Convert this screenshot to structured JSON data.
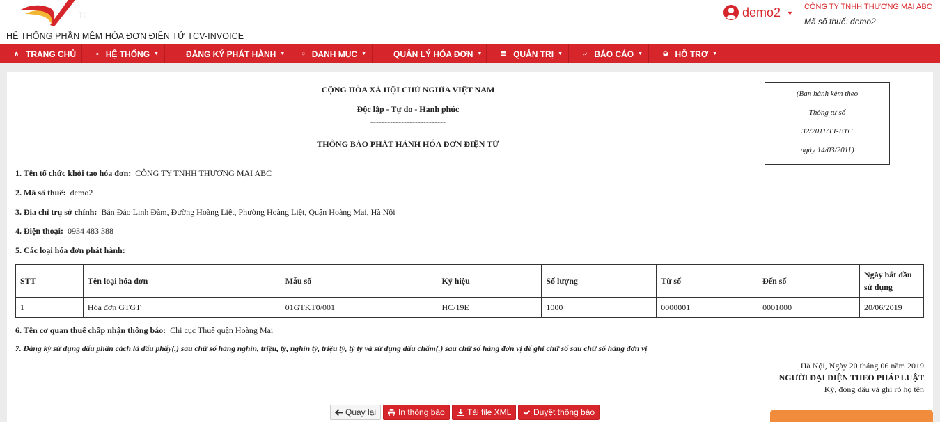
{
  "header": {
    "app_title": "HỆ THỐNG PHẦN MỀM HÓA ĐƠN ĐIỆN TỬ TCV-INVOICE",
    "user_name": "demo2",
    "company": "CÔNG TY TNHH THƯƠNG MẠI ABC",
    "tax_code": "Mã số thuế: demo2"
  },
  "nav": {
    "items": [
      {
        "label": "TRANG CHỦ",
        "icon": "home-icon"
      },
      {
        "label": "HỆ THỐNG",
        "icon": "gear-icon"
      },
      {
        "label": "ĐĂNG KÝ PHÁT HÀNH",
        "icon": "plane-icon"
      },
      {
        "label": "DANH MỤC",
        "icon": "book-icon"
      },
      {
        "label": "QUẢN LÝ HÓA ĐƠN",
        "icon": "file-icon"
      },
      {
        "label": "QUẢN TRỊ",
        "icon": "server-icon"
      },
      {
        "label": "BÁO CÁO",
        "icon": "chart-icon"
      },
      {
        "label": "HỖ TRỢ",
        "icon": "cube-icon"
      }
    ]
  },
  "document": {
    "national_title": "CỘNG HÒA XÃ HỘI CHỦ NGHĨA VIỆT NAM",
    "motto": "Độc lập - Tự do - Hạnh phúc",
    "separator": "---------------------------",
    "title": "THÔNG BÁO PHÁT HÀNH HÓA ĐƠN ĐIỆN TỬ",
    "ban_hanh": [
      "(Ban hành kèm theo",
      "Thông tư số",
      "32/2011/TT-BTC",
      "ngày 14/03/2011)"
    ],
    "fields": [
      {
        "label": "1. Tên tổ chức khởi tạo hóa đơn:",
        "value": "CÔNG TY TNHH THƯƠNG MẠI ABC"
      },
      {
        "label": "2. Mã số thuế:",
        "value": "demo2"
      },
      {
        "label": "3. Địa chỉ trụ sở chính:",
        "value": "Bán Đảo Linh Đàm, Đường Hoàng Liệt, Phường Hoàng Liệt, Quận Hoàng Mai, Hà Nội"
      },
      {
        "label": "4. Điện thoại:",
        "value": "0934 483 388"
      },
      {
        "label": "5. Các loại hóa đơn phát hành:",
        "value": ""
      }
    ],
    "table": {
      "headers": [
        "STT",
        "Tên loại hóa đơn",
        "Mẫu số",
        "Ký hiệu",
        "Số lượng",
        "Từ số",
        "Đến số",
        "Ngày bắt đầu sử dụng"
      ],
      "rows": [
        [
          "1",
          "Hóa đơn GTGT",
          "01GTKT0/001",
          "HC/19E",
          "1000",
          "0000001",
          "0001000",
          "20/06/2019"
        ]
      ]
    },
    "field6": {
      "label": "6. Tên cơ quan thuế chấp nhận thông báo:",
      "value": "Chi cục Thuế quận Hoàng Mai"
    },
    "field7": "7. Đăng ký sử dụng dấu phân cách là dấu phẩy(,) sau chữ số hàng nghìn, triệu, tỷ, nghìn tỷ, triệu tỷ, tỷ tỷ và sử dụng dấu chấm(.) sau chữ số hàng đơn vị để ghi chữ số sau chữ số hàng đơn vị",
    "signature": {
      "date": "Hà Nội, Ngày 20 tháng 06 năm 2019",
      "title": "NGƯỜI ĐẠI DIỆN THEO PHÁP LUẬT",
      "note": "Ký, đóng dấu và ghi rõ họ tên"
    }
  },
  "buttons": {
    "back": "Quay lại",
    "print": "In thông báo",
    "download_xml": "Tải file XML",
    "approve": "Duyệt thông báo"
  },
  "colors": {
    "brand": "#d7262b",
    "accent": "#f08c3c"
  }
}
